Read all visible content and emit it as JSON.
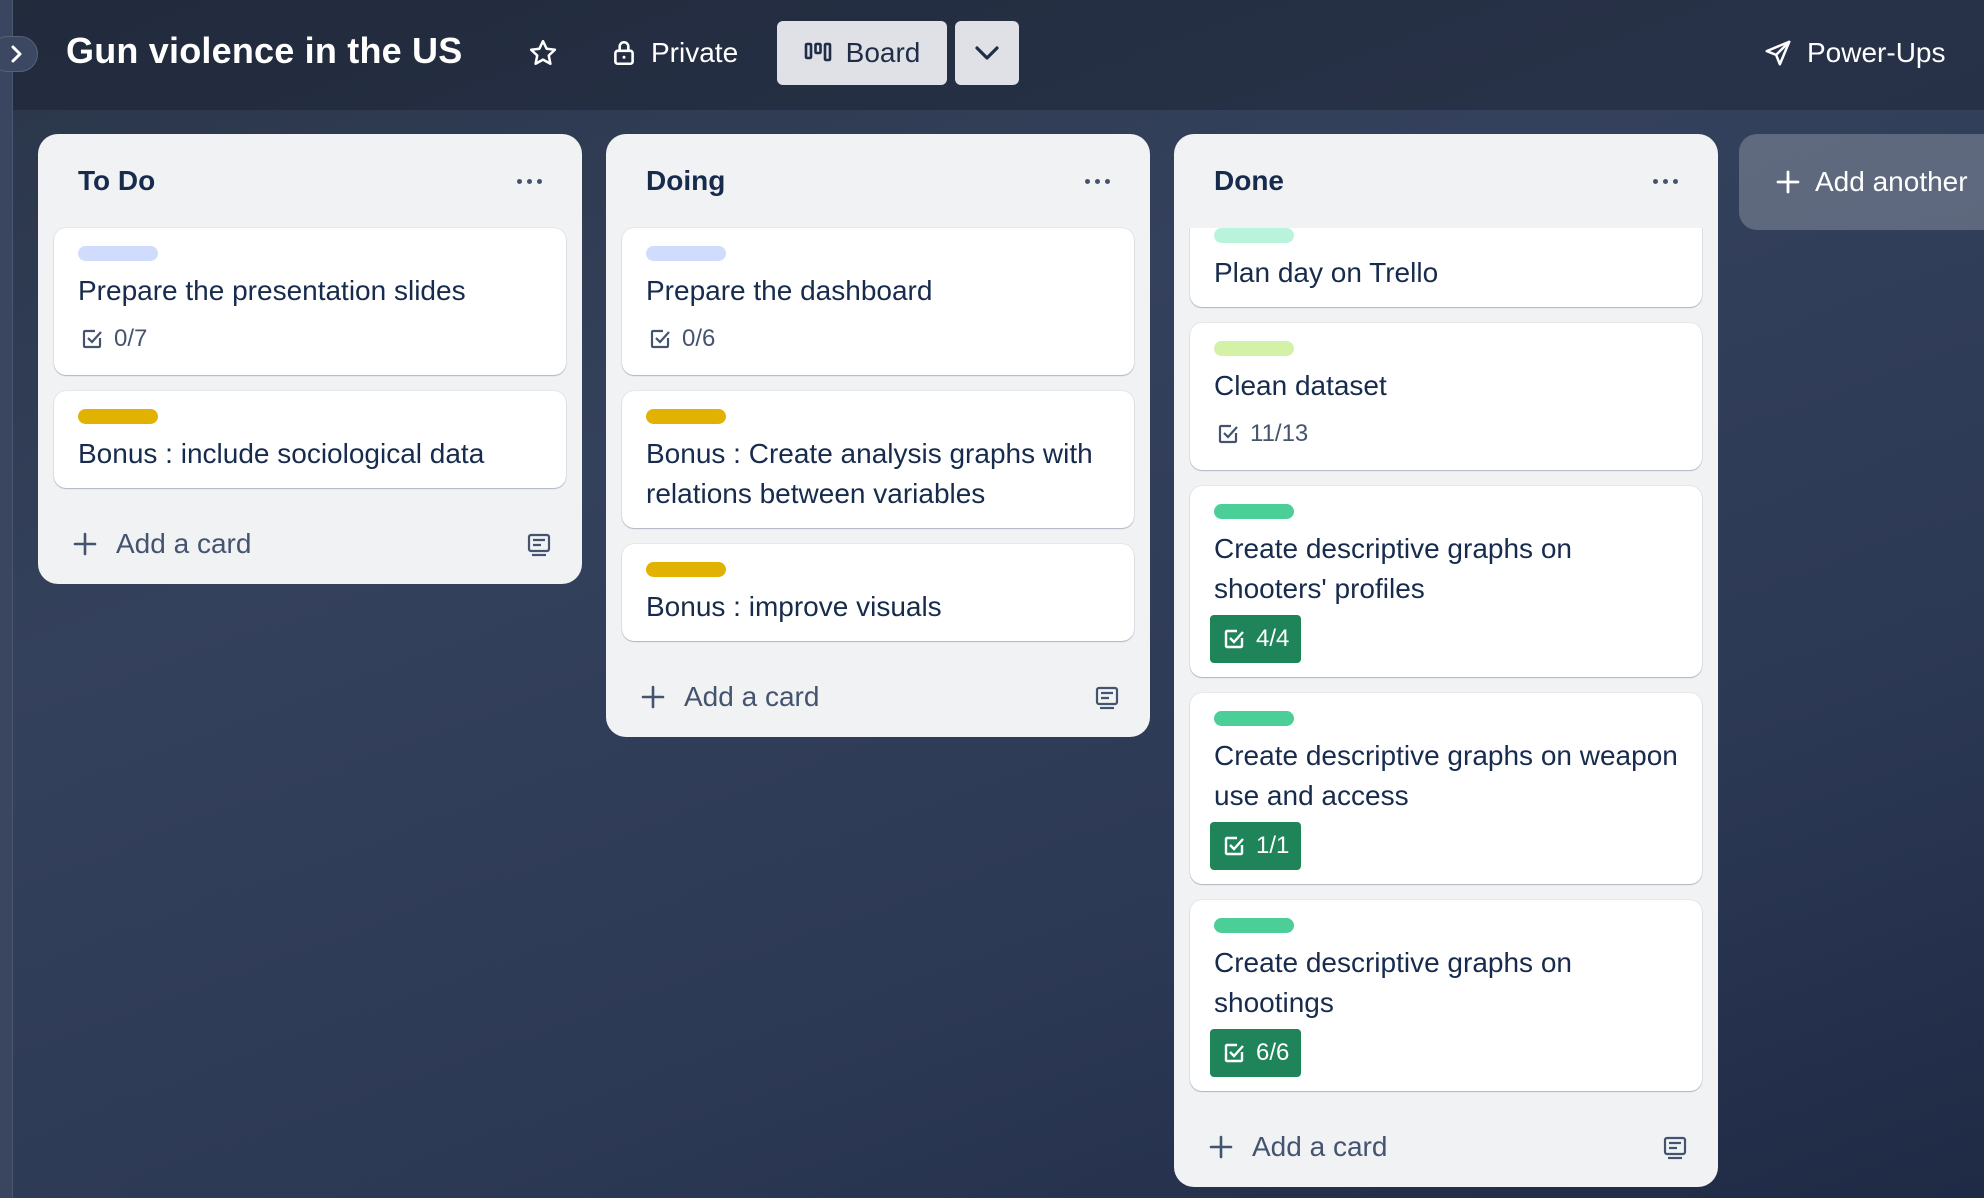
{
  "board": {
    "title": "Gun violence in the US",
    "visibility": "Private",
    "view": "Board",
    "power_ups": "Power-Ups"
  },
  "icons": {
    "sidebar_toggle": "chevron-right-icon",
    "star": "star-icon",
    "lock": "lock-icon",
    "board_view": "board-icon",
    "view_dropdown": "chevron-down-icon",
    "power_ups": "rocket-icon",
    "add": "plus-icon",
    "template": "card-template-icon",
    "checklist": "checklist-icon",
    "list_menu": "ellipsis-icon"
  },
  "colors": {
    "label_blue": "#cfdcfc",
    "label_yellow": "#e2b203",
    "label_mint": "#baf3db",
    "label_lime": "#d3f1a7",
    "label_green": "#4bce97",
    "checklist_complete": "#1f845a"
  },
  "lists": [
    {
      "title": "To Do",
      "add_card": "Add a card",
      "cards": [
        {
          "title": "Prepare the presentation slides",
          "label_color": "blue",
          "checklist": "0/7"
        },
        {
          "title": "Bonus : include sociological data",
          "label_color": "yellow"
        }
      ]
    },
    {
      "title": "Doing",
      "add_card": "Add a card",
      "cards": [
        {
          "title": "Prepare the dashboard",
          "label_color": "blue",
          "checklist": "0/6"
        },
        {
          "title": "Bonus : Create analysis graphs with relations between variables",
          "label_color": "yellow"
        },
        {
          "title": "Bonus : improve visuals",
          "label_color": "yellow"
        }
      ]
    },
    {
      "title": "Done",
      "add_card": "Add a card",
      "cards": [
        {
          "title": "Plan day on Trello",
          "label_color": "mint"
        },
        {
          "title": "Clean dataset",
          "label_color": "lime",
          "checklist": "11/13"
        },
        {
          "title": "Create descriptive graphs on shooters' profiles",
          "label_color": "green",
          "checklist": "4/4",
          "checklist_complete": true
        },
        {
          "title": "Create descriptive graphs on weapon use and access",
          "label_color": "green",
          "checklist": "1/1",
          "checklist_complete": true
        },
        {
          "title": "Create descriptive graphs on shootings",
          "label_color": "green",
          "checklist": "6/6",
          "checklist_complete": true
        }
      ]
    }
  ],
  "add_list": "Add another"
}
